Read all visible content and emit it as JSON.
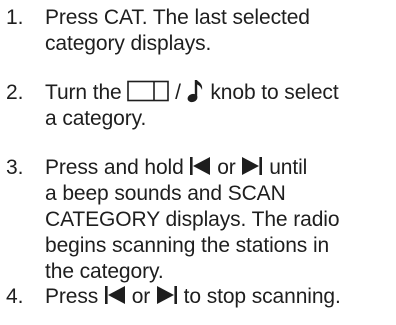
{
  "steps": [
    {
      "number": "1.",
      "lines": [
        "Press CAT. The last selected",
        "category displays."
      ]
    },
    {
      "number": "2.",
      "line1_prefix": "Turn the",
      "line1_sep": "/",
      "line1_suffix": "knob to select",
      "line2": "a category.",
      "icons": [
        "category-box-icon",
        "music-note-icon"
      ]
    },
    {
      "number": "3.",
      "line1_prefix": "Press and hold",
      "line1_mid": "or",
      "line1_suffix": "until",
      "lines_rest": [
        "a beep sounds and SCAN",
        "CATEGORY displays. The radio",
        "begins scanning the stations in",
        "the category."
      ],
      "icons": [
        "seek-back-icon",
        "seek-forward-icon"
      ]
    },
    {
      "number": "4.",
      "prefix": "Press",
      "mid": "or",
      "suffix": "to stop scanning.",
      "icons": [
        "seek-back-icon",
        "seek-forward-icon"
      ]
    }
  ]
}
